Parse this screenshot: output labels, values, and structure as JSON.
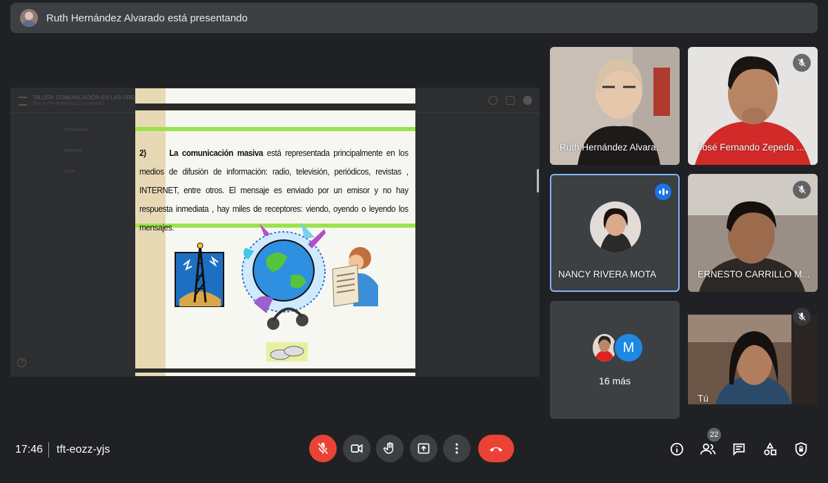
{
  "header": {
    "presenting_text": "Ruth Hernández Alvarado está presentando"
  },
  "presentation": {
    "doc_title": "TALLER: COMUNICACIÓN EN LAS ORG...",
    "doc_subtitle": "Sitio: RUTH HERNÁNDEZ ALVARADO",
    "ghost_items": [
      "Simulación",
      "Material",
      "Libro"
    ],
    "slide_number": "2)",
    "slide_bold": "La comunicación masiva",
    "slide_text": " está representada principalmente en los medios de difusión de información: radio, televisión, periódicos, revistas , INTERNET, entre otros. El mensaje es enviado por un emisor y no hay respuesta inmediata , hay miles de receptores: viendo, oyendo o leyendo los mensajes."
  },
  "participants": [
    {
      "name": "Ruth Hernández Alvara...",
      "muted": false
    },
    {
      "name": "José Fernando Zepeda ...",
      "muted": true
    },
    {
      "name": "NANCY RIVERA MOTA",
      "muted": false,
      "speaking": true
    },
    {
      "name": "ERNESTO CARRILLO M...",
      "muted": true
    },
    {
      "name": "Tú",
      "muted": true
    }
  ],
  "overflow": {
    "avatar_letter": "M",
    "label": "16 más"
  },
  "meeting": {
    "time": "17:46",
    "code": "tft-eozz-yjs",
    "people_count": "22"
  },
  "colors": {
    "end_call": "#ea4335",
    "speaking": "#1a73e8",
    "background": "#202124",
    "tile": "#3c4043"
  }
}
